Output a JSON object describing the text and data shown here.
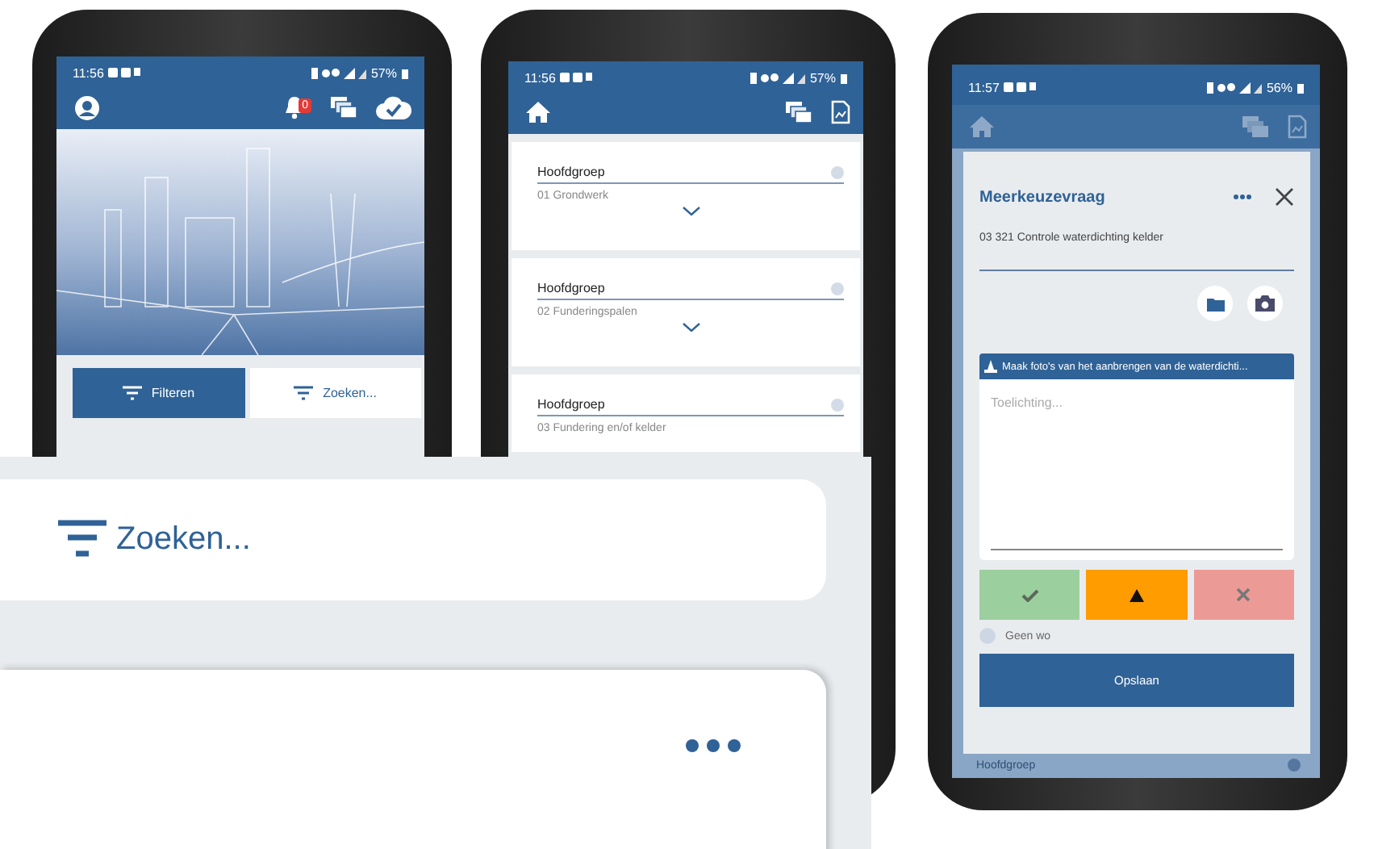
{
  "phones": [
    {
      "kind": "home",
      "status": {
        "time": "11:56",
        "battery": "57%"
      },
      "notification_count": "0",
      "buttons": [
        {
          "label": "Filteren",
          "selected": true
        },
        {
          "label": "Zoeken...",
          "selected": false
        }
      ]
    },
    {
      "kind": "list",
      "status": {
        "time": "11:56",
        "battery": "57%"
      },
      "groups": [
        {
          "label": "Hoofdgroep",
          "value": "01 Grondwerk",
          "expandable": true
        },
        {
          "label": "Hoofdgroep",
          "value": "02 Funderingspalen",
          "expandable": true
        },
        {
          "label": "Hoofdgroep",
          "value": "03 Fundering en/of kelder",
          "expandable": false
        }
      ]
    },
    {
      "kind": "question",
      "status": {
        "time": "11:57",
        "battery": "56%"
      },
      "title": "Meerkeuzevraag",
      "question": "03 321 Controle waterdichting kelder",
      "instruction": "Maak foto's van het aanbrengen van de waterdichti...",
      "placeholder": "Toelichting...",
      "answers": [
        {
          "kind": "ok",
          "color": "#9ccf9e"
        },
        {
          "kind": "warning",
          "color": "#ff9c00"
        },
        {
          "kind": "fail",
          "color": "#ec9a95"
        }
      ],
      "option": {
        "label": "Geen wo",
        "checked": false
      },
      "save_label": "Opslaan",
      "background_label": "Hoofdgroep"
    }
  ],
  "zoom_panel": {
    "search_label": "Zoeken..."
  }
}
